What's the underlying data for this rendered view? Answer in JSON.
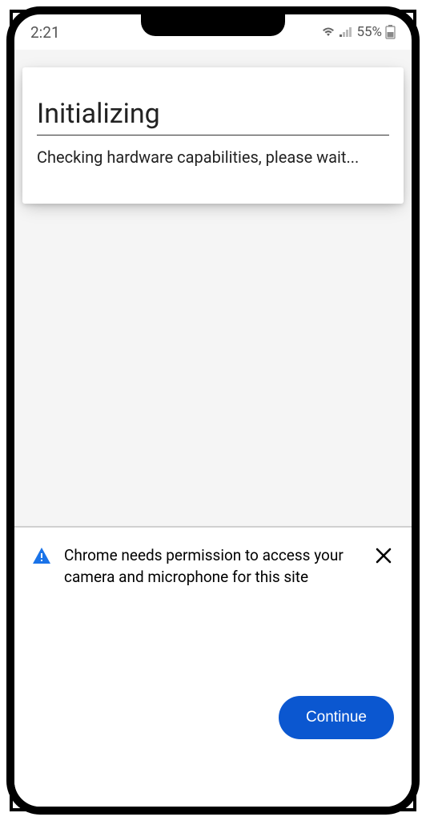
{
  "status_bar": {
    "time": "2:21",
    "battery_percent": "55%"
  },
  "card": {
    "title": "Initializing",
    "body": "Checking hardware capabilities, please wait..."
  },
  "permission_sheet": {
    "message": "Chrome needs permission to access your camera and microphone for this site",
    "continue_label": "Continue"
  }
}
